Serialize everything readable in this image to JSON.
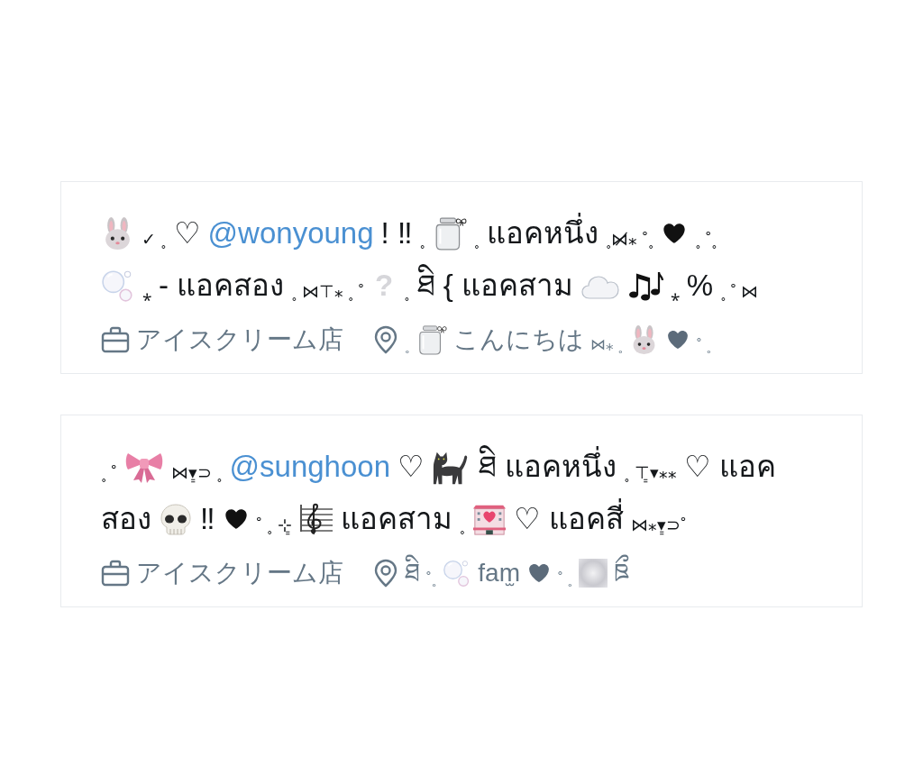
{
  "profiles": [
    {
      "bio_lines": [
        [
          {
            "kind": "emoji"
          },
          {
            "kind": "deco",
            "text": "✓ ˳"
          },
          {
            "kind": "text",
            "text": "♡"
          },
          {
            "kind": "mention",
            "text": "@wonyoung"
          },
          {
            "kind": "text",
            "text": "! ‼"
          },
          {
            "kind": "deco",
            "text": "˳"
          },
          {
            "kind": "emoji"
          },
          {
            "kind": "deco",
            "text": "˳"
          },
          {
            "kind": "text",
            "text": "แอคหนึ่ง"
          },
          {
            "kind": "deco",
            "text": "˳⋈̸⁎ ˚˳"
          },
          {
            "kind": "emoji"
          },
          {
            "kind": "deco",
            "text": "˳ ˚˳"
          }
        ],
        [
          {
            "kind": "emoji"
          },
          {
            "kind": "deco",
            "text": "⁎"
          },
          {
            "kind": "text",
            "text": "- แอคสอง"
          },
          {
            "kind": "deco",
            "text": "˳ ⋈⊤⁎ ˳ ˚"
          },
          {
            "kind": "faint",
            "text": "?"
          },
          {
            "kind": "deco",
            "text": "˳"
          },
          {
            "kind": "text",
            "text": "ཐི { แอคสาม"
          },
          {
            "kind": "emoji"
          },
          {
            "kind": "emoji"
          },
          {
            "kind": "deco",
            "text": "⁎"
          },
          {
            "kind": "text",
            "text": "%"
          },
          {
            "kind": "deco",
            "text": "˳ ˚ ⋈"
          }
        ]
      ],
      "category": "アイスクリーム店",
      "location": [
        {
          "kind": "deco",
          "text": "˳"
        },
        {
          "kind": "emoji"
        },
        {
          "kind": "text",
          "text": "こんにちは"
        },
        {
          "kind": "deco",
          "text": "⋈⁎ ˳"
        },
        {
          "kind": "emoji"
        },
        {
          "kind": "emoji"
        },
        {
          "kind": "deco",
          "text": "˚ ˳"
        }
      ]
    },
    {
      "bio_lines": [
        [
          {
            "kind": "deco",
            "text": "˳ ˚"
          },
          {
            "kind": "emoji"
          },
          {
            "kind": "deco",
            "text": "⋈▾͇⊃ ˳"
          },
          {
            "kind": "mention",
            "text": "@sunghoon"
          },
          {
            "kind": "text",
            "text": "♡"
          },
          {
            "kind": "emoji"
          },
          {
            "kind": "text",
            "text": "ཐི แอคหนึ่ง"
          },
          {
            "kind": "deco",
            "text": "˳ ⊤͇▾⁎⁎"
          },
          {
            "kind": "text",
            "text": "♡ แอค"
          }
        ],
        [
          {
            "kind": "text",
            "text": "สอง"
          },
          {
            "kind": "emoji"
          },
          {
            "kind": "text",
            "text": "‼"
          },
          {
            "kind": "emoji"
          },
          {
            "kind": "deco",
            "text": "˚ ˳ ⊹͇"
          },
          {
            "kind": "emoji"
          },
          {
            "kind": "text",
            "text": "แอคสาม"
          },
          {
            "kind": "deco",
            "text": "˳"
          },
          {
            "kind": "emoji"
          },
          {
            "kind": "text",
            "text": "♡ แอคสี่"
          },
          {
            "kind": "deco",
            "text": "⋈⁎▾͇⊃˚"
          }
        ]
      ],
      "category": "アイスクリーム店",
      "location": [
        {
          "kind": "text",
          "text": "ཐི"
        },
        {
          "kind": "deco",
          "text": "˚˳"
        },
        {
          "kind": "emoji"
        },
        {
          "kind": "text",
          "text": "fam̫"
        },
        {
          "kind": "emoji"
        },
        {
          "kind": "deco",
          "text": "˚ ˳"
        },
        {
          "kind": "emoji"
        },
        {
          "kind": "text",
          "text": "ཋྀ"
        }
      ]
    }
  ]
}
